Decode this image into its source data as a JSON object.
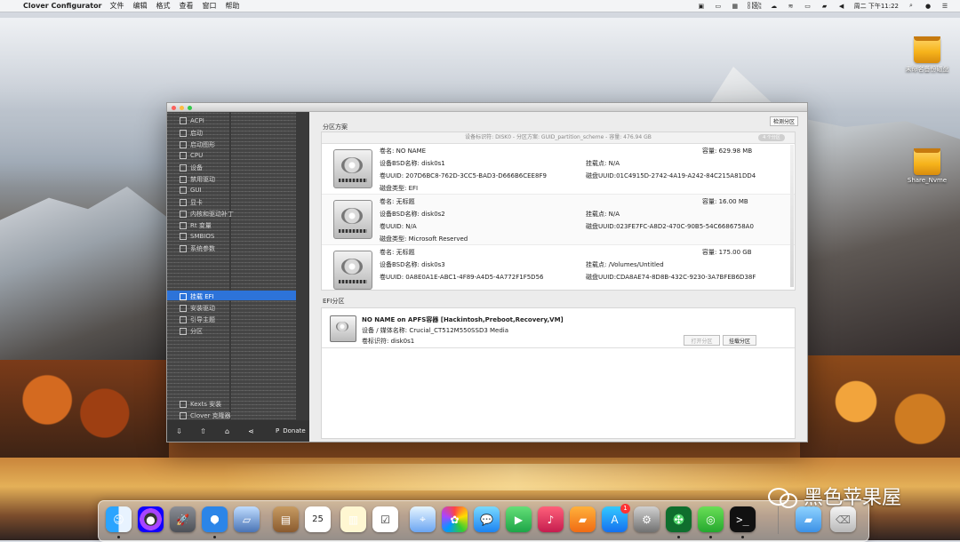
{
  "menubar": {
    "app_name": "Clover Configurator",
    "items": [
      "文件",
      "编辑",
      "格式",
      "查看",
      "窗口",
      "帮助"
    ],
    "status": {
      "network_up": "0 KB/s",
      "network_down": "0 KB/s",
      "clock": "周二 下午11:22"
    }
  },
  "desktop": {
    "items": [
      {
        "label": "未命名备份磁盘"
      },
      {
        "label": "Share_Nvme"
      }
    ]
  },
  "window": {
    "sidebar": {
      "items": [
        "ACPI",
        "启动",
        "启动图形",
        "CPU",
        "设备",
        "禁用驱动",
        "GUI",
        "显卡",
        "内核和驱动补丁",
        "Rt 变量",
        "SMBIOS",
        "系统参数",
        "挂载 EFI",
        "安装驱动",
        "引导主题",
        "分区",
        "Kexts 安装",
        "Clover 克隆器"
      ],
      "selected_index": 12,
      "toolbar": {
        "donate": "Donate"
      }
    },
    "top_button": "检测分区",
    "partition_section_label": "分区方案",
    "partition_header": "设备标识符: DISK0 - 分区方案: GUID_partition_scheme - 容量: 476.94 GB",
    "partition_header_pill": "4 个分区",
    "partitions": [
      {
        "volume_name_label": "卷名:",
        "volume_name": "NO NAME",
        "bsd_label": "设备BSD名称:",
        "bsd": "disk0s1",
        "uuid_label": "卷UUID:",
        "uuid": "207D6BC8-762D-3CC5-BAD3-D666B6CEE8F9",
        "type_label": "磁盘类型:",
        "type": "EFI",
        "size_label": "容量:",
        "size": "629.98 MB",
        "mount_label": "挂载点:",
        "mount": "N/A",
        "disk_uuid_label": "磁盘UUID:",
        "disk_uuid": "01C4915D-2742-4A19-A242-84C215A81DD4"
      },
      {
        "volume_name_label": "卷名:",
        "volume_name": "无标题",
        "bsd_label": "设备BSD名称:",
        "bsd": "disk0s2",
        "uuid_label": "卷UUID:",
        "uuid": "N/A",
        "type_label": "磁盘类型:",
        "type": "Microsoft Reserved",
        "size_label": "容量:",
        "size": "16.00 MB",
        "mount_label": "挂载点:",
        "mount": "N/A",
        "disk_uuid_label": "磁盘UUID:",
        "disk_uuid": "023FE7FC-A8D2-470C-90B5-54C6686758A0"
      },
      {
        "volume_name_label": "卷名:",
        "volume_name": "无标题",
        "bsd_label": "设备BSD名称:",
        "bsd": "disk0s3",
        "uuid_label": "卷UUID:",
        "uuid": "0A8E0A1E-ABC1-4F89-A4D5-4A772F1F5D56",
        "size_label": "容量:",
        "size": "175.00 GB",
        "mount_label": "挂载点:",
        "mount": "/Volumes/Untitled",
        "disk_uuid_label": "磁盘UUID:",
        "disk_uuid": "CDA8AE74-8D8B-432C-9230-3A7BFEB6D38F"
      }
    ],
    "efi_section_label": "EFI分区",
    "efi": {
      "title": "NO NAME on APFS容器 [Hackintosh,Preboot,Recovery,VM]",
      "device_label": "设备 / 媒体名称:",
      "device": "Crucial_CT512M550SSD3 Media",
      "volume_label": "卷标识符:",
      "volume": "disk0s1",
      "open_button": "打开分区",
      "mount_button": "挂载分区"
    }
  },
  "dock": {
    "calendar_day": "25",
    "app_store_badge": "1"
  },
  "watermark": {
    "text": "黑色苹果屋"
  },
  "colors": {
    "selection_blue": "#2d73d9",
    "sidebar_dark": "#3a3a3a",
    "finder_blue": "#1f8cf0"
  }
}
